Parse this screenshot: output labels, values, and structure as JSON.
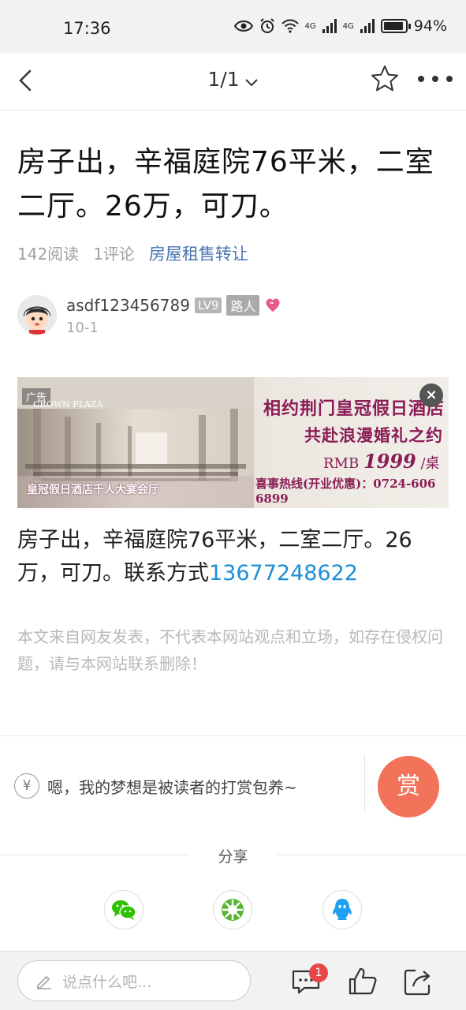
{
  "status_bar": {
    "time": "17:36",
    "network1": "4G",
    "network2": "4G",
    "battery": "94%"
  },
  "nav": {
    "page_indicator": "1/1"
  },
  "post": {
    "title": "房子出，辛福庭院76平米，二室二厅。26万，可刀。",
    "reads": "142阅读",
    "comments": "1评论",
    "category": "房屋租售转让"
  },
  "author": {
    "name": "asdf123456789",
    "level": "LV9",
    "role": "路人",
    "date": "10-1"
  },
  "ad": {
    "tag": "广告",
    "brand": "CROWN PLAZA",
    "line1": "相约荆门皇冠假日酒店",
    "line2": "共赴浪漫婚礼之约",
    "price_prefix": "RMB",
    "price": "1999",
    "price_suffix": "/桌",
    "hotline": "喜事热线(开业优惠)：0724-606 6899",
    "caption": "皇冠假日酒店千人大宴会厅"
  },
  "content": {
    "text": "房子出，辛福庭院76平米，二室二厅。26万，可刀。联系方式",
    "phone": "13677248622",
    "disclaimer": "本文来自网友发表，不代表本网站观点和立场，如存在侵权问题，请与本网站联系删除！"
  },
  "reward": {
    "yen_symbol": "¥",
    "placeholder": "嗯，我的梦想是被读者的打赏包养~",
    "button": "赏"
  },
  "share": {
    "label": "分享"
  },
  "bottom_bar": {
    "comment_placeholder": "说点什么吧...",
    "comment_badge": "1"
  },
  "colors": {
    "accent_link": "#4a74b0",
    "phone_link": "#1e8fd6",
    "reward_button": "#f2735a",
    "badge": "#e8474a",
    "ad_text": "#8a1c55",
    "wechat": "#2dc100",
    "moments": "#57b630",
    "qq": "#1ea0f0"
  }
}
